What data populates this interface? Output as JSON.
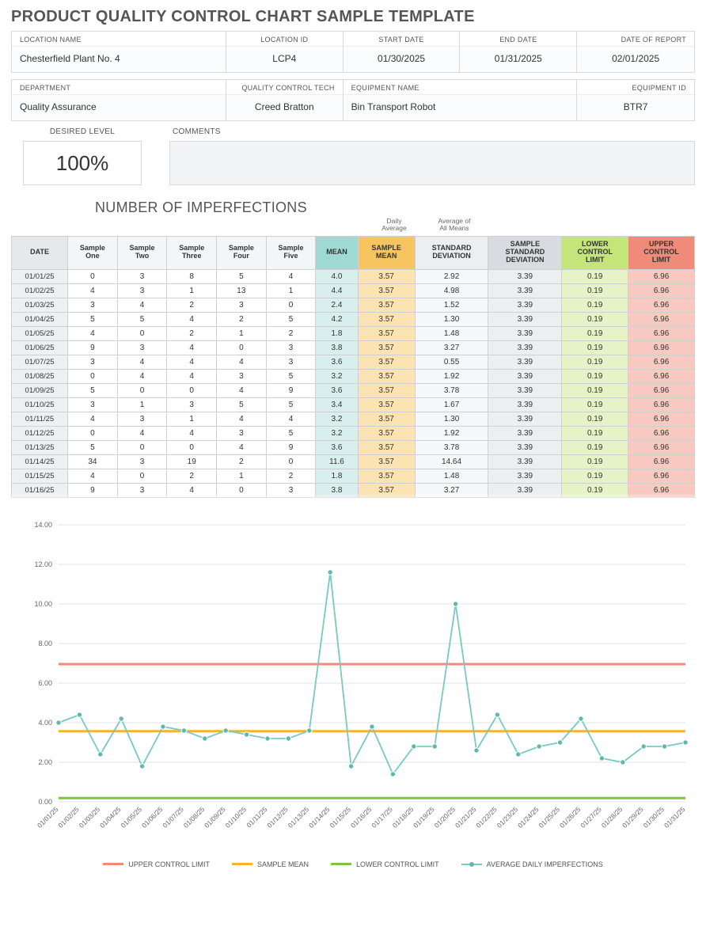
{
  "title": "PRODUCT QUALITY CONTROL CHART SAMPLE TEMPLATE",
  "header1": {
    "labels": [
      "LOCATION NAME",
      "LOCATION ID",
      "START DATE",
      "END DATE",
      "DATE OF REPORT"
    ],
    "values": [
      "Chesterfield Plant No. 4",
      "LCP4",
      "01/30/2025",
      "01/31/2025",
      "02/01/2025"
    ]
  },
  "header2": {
    "labels": [
      "DEPARTMENT",
      "QUALITY CONTROL TECH",
      "EQUIPMENT NAME",
      "EQUIPMENT ID"
    ],
    "values": [
      "Quality Assurance",
      "Creed Bratton",
      "Bin Transport Robot",
      "BTR7"
    ]
  },
  "desired_label": "DESIRED LEVEL",
  "desired_value": "100%",
  "comments_label": "COMMENTS",
  "comments_value": "",
  "imperfections_title": "NUMBER OF IMPERFECTIONS",
  "ann_daily": "Daily\nAverage",
  "ann_all": "Average of\nAll Means",
  "columns": [
    "DATE",
    "Sample One",
    "Sample Two",
    "Sample Three",
    "Sample Four",
    "Sample Five",
    "MEAN",
    "SAMPLE MEAN",
    "STANDARD DEVIATION",
    "SAMPLE STANDARD DEVIATION",
    "LOWER CONTROL LIMIT",
    "UPPER CONTROL LIMIT"
  ],
  "rows": [
    [
      "01/01/25",
      "0",
      "3",
      "8",
      "5",
      "4",
      "4.0",
      "3.57",
      "2.92",
      "3.39",
      "0.19",
      "6.96"
    ],
    [
      "01/02/25",
      "4",
      "3",
      "1",
      "13",
      "1",
      "4.4",
      "3.57",
      "4.98",
      "3.39",
      "0.19",
      "6.96"
    ],
    [
      "01/03/25",
      "3",
      "4",
      "2",
      "3",
      "0",
      "2.4",
      "3.57",
      "1.52",
      "3.39",
      "0.19",
      "6.96"
    ],
    [
      "01/04/25",
      "5",
      "5",
      "4",
      "2",
      "5",
      "4.2",
      "3.57",
      "1.30",
      "3.39",
      "0.19",
      "6.96"
    ],
    [
      "01/05/25",
      "4",
      "0",
      "2",
      "1",
      "2",
      "1.8",
      "3.57",
      "1.48",
      "3.39",
      "0.19",
      "6.96"
    ],
    [
      "01/06/25",
      "9",
      "3",
      "4",
      "0",
      "3",
      "3.8",
      "3.57",
      "3.27",
      "3.39",
      "0.19",
      "6.96"
    ],
    [
      "01/07/25",
      "3",
      "4",
      "4",
      "4",
      "3",
      "3.6",
      "3.57",
      "0.55",
      "3.39",
      "0.19",
      "6.96"
    ],
    [
      "01/08/25",
      "0",
      "4",
      "4",
      "3",
      "5",
      "3.2",
      "3.57",
      "1.92",
      "3.39",
      "0.19",
      "6.96"
    ],
    [
      "01/09/25",
      "5",
      "0",
      "0",
      "4",
      "9",
      "3.6",
      "3.57",
      "3.78",
      "3.39",
      "0.19",
      "6.96"
    ],
    [
      "01/10/25",
      "3",
      "1",
      "3",
      "5",
      "5",
      "3.4",
      "3.57",
      "1.67",
      "3.39",
      "0.19",
      "6.96"
    ],
    [
      "01/11/25",
      "4",
      "3",
      "1",
      "4",
      "4",
      "3.2",
      "3.57",
      "1.30",
      "3.39",
      "0.19",
      "6.96"
    ],
    [
      "01/12/25",
      "0",
      "4",
      "4",
      "3",
      "5",
      "3.2",
      "3.57",
      "1.92",
      "3.39",
      "0.19",
      "6.96"
    ],
    [
      "01/13/25",
      "5",
      "0",
      "0",
      "4",
      "9",
      "3.6",
      "3.57",
      "3.78",
      "3.39",
      "0.19",
      "6.96"
    ],
    [
      "01/14/25",
      "34",
      "3",
      "19",
      "2",
      "0",
      "11.6",
      "3.57",
      "14.64",
      "3.39",
      "0.19",
      "6.96"
    ],
    [
      "01/15/25",
      "4",
      "0",
      "2",
      "1",
      "2",
      "1.8",
      "3.57",
      "1.48",
      "3.39",
      "0.19",
      "6.96"
    ],
    [
      "01/16/25",
      "9",
      "3",
      "4",
      "0",
      "3",
      "3.8",
      "3.57",
      "3.27",
      "3.39",
      "0.19",
      "6.96"
    ]
  ],
  "chart_data": {
    "type": "line",
    "title": "",
    "xlabel": "",
    "ylabel": "",
    "ylim": [
      0,
      14
    ],
    "yticks": [
      0,
      2,
      4,
      6,
      8,
      10,
      12,
      14
    ],
    "categories": [
      "01/01/25",
      "01/02/25",
      "01/03/25",
      "01/04/25",
      "01/05/25",
      "01/06/25",
      "01/07/25",
      "01/08/25",
      "01/09/25",
      "01/10/25",
      "01/11/25",
      "01/12/25",
      "01/13/25",
      "01/14/25",
      "01/15/25",
      "01/16/25",
      "01/17/25",
      "01/18/25",
      "01/19/25",
      "01/20/25",
      "01/21/25",
      "01/22/25",
      "01/23/25",
      "01/24/25",
      "01/25/25",
      "01/26/25",
      "01/27/25",
      "01/28/25",
      "01/29/25",
      "01/30/25",
      "01/31/25"
    ],
    "series": [
      {
        "name": "UPPER CONTROL LIMIT",
        "color": "#f08b7a",
        "const": 6.96
      },
      {
        "name": "SAMPLE MEAN",
        "color": "#f6b42c",
        "const": 3.57
      },
      {
        "name": "LOWER CONTROL LIMIT",
        "color": "#84c13f",
        "const": 0.19
      },
      {
        "name": "AVERAGE DAILY IMPERFECTIONS",
        "color": "#79c9c2",
        "values": [
          4.0,
          4.4,
          2.4,
          4.2,
          1.8,
          3.8,
          3.6,
          3.2,
          3.6,
          3.4,
          3.2,
          3.2,
          3.6,
          11.6,
          1.8,
          3.8,
          1.4,
          2.8,
          2.8,
          10.0,
          2.6,
          4.4,
          2.4,
          2.8,
          3.0,
          4.2,
          2.2,
          2.0,
          2.8,
          2.8,
          3.0
        ]
      }
    ],
    "legend": [
      "UPPER CONTROL LIMIT",
      "SAMPLE MEAN",
      "LOWER CONTROL LIMIT",
      "AVERAGE DAILY IMPERFECTIONS"
    ]
  }
}
